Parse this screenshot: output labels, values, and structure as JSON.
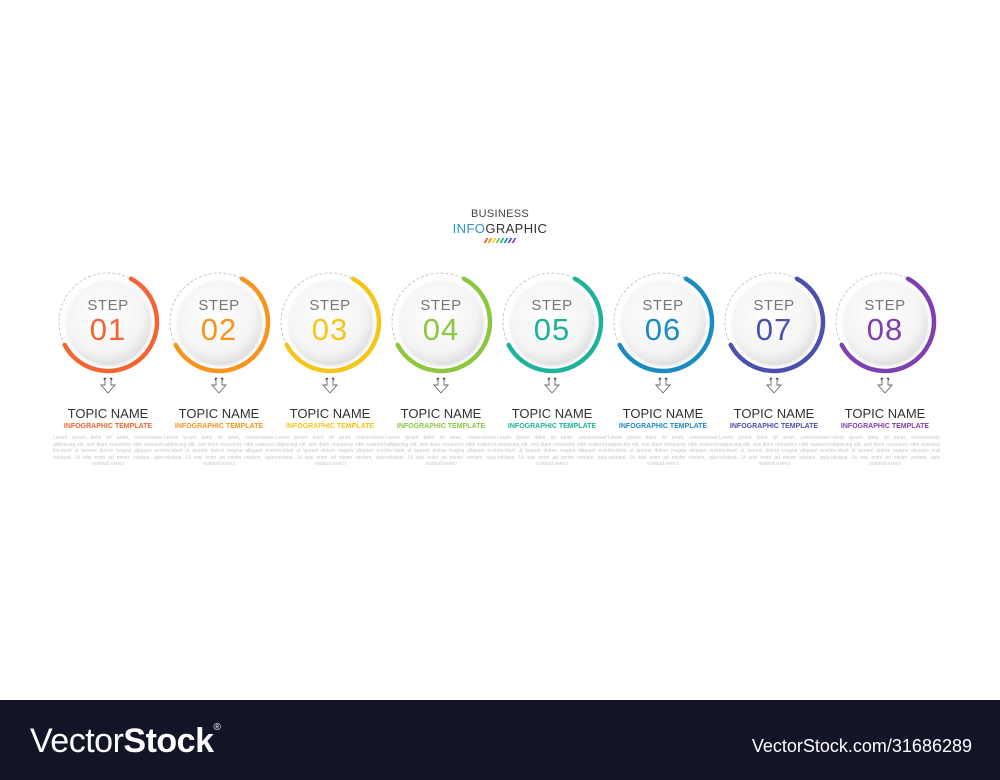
{
  "header": {
    "line1": "BUSINESS",
    "line2_highlight": "INFO",
    "line2_rest": "GRAPHIC",
    "rainbow_colors": [
      "#f15a24",
      "#f7931e",
      "#f9d423",
      "#8cc63f",
      "#1abc9c",
      "#1a8fc6",
      "#5b4fb0",
      "#8e44ad"
    ]
  },
  "steps": [
    {
      "label": "STEP",
      "number": "01",
      "color": "#f26532",
      "topic": "TOPIC NAME",
      "subtitle": "INFOGRAPHIC TEMPLATE",
      "body": "Lorem ipsum dolor sit amet, consectetuer adipiscing elit, sed diam nonummy nibh euismod tincidunt ut laoreet dolore magna aliquam erat volutpat. Ut wisi enim ad minim veniam, quis nostrud exerci"
    },
    {
      "label": "STEP",
      "number": "02",
      "color": "#f7941d",
      "topic": "TOPIC NAME",
      "subtitle": "INFOGRAPHIC TEMPLATE",
      "body": "Lorem ipsum dolor sit amet, consectetuer adipiscing elit, sed diam nonummy nibh euismod tincidunt ut laoreet dolore magna aliquam erat volutpat. Ut wisi enim ad minim veniam, quis nostrud exerci"
    },
    {
      "label": "STEP",
      "number": "03",
      "color": "#f5c518",
      "topic": "TOPIC NAME",
      "subtitle": "INFOGRAPHIC TEMPLATE",
      "body": "Lorem ipsum dolor sit amet, consectetuer adipiscing elit, sed diam nonummy nibh euismod tincidunt ut laoreet dolore magna aliquam erat volutpat. Ut wisi enim ad minim veniam, quis nostrud exerci"
    },
    {
      "label": "STEP",
      "number": "04",
      "color": "#8dc63f",
      "topic": "TOPIC NAME",
      "subtitle": "INFOGRAPHIC TEMPLATE",
      "body": "Lorem ipsum dolor sit amet, consectetuer adipiscing elit, sed diam nonummy nibh euismod tincidunt ut laoreet dolore magna aliquam erat volutpat. Ut wisi enim ad minim veniam, quis nostrud exerci"
    },
    {
      "label": "STEP",
      "number": "05",
      "color": "#1db39b",
      "topic": "TOPIC NAME",
      "subtitle": "INFOGRAPHIC TEMPLATE",
      "body": "Lorem ipsum dolor sit amet, consectetuer adipiscing elit, sed diam nonummy nibh euismod tincidunt ut laoreet dolore magna aliquam erat volutpat. Ut wisi enim ad minim veniam, quis nostrud exerci"
    },
    {
      "label": "STEP",
      "number": "06",
      "color": "#1a8cc2",
      "topic": "TOPIC NAME",
      "subtitle": "INFOGRAPHIC TEMPLATE",
      "body": "Lorem ipsum dolor sit amet, consectetuer adipiscing elit, sed diam nonummy nibh euismod tincidunt ut laoreet dolore magna aliquam erat volutpat. Ut wisi enim ad minim veniam, quis nostrud exerci"
    },
    {
      "label": "STEP",
      "number": "07",
      "color": "#4b4fae",
      "topic": "TOPIC NAME",
      "subtitle": "INFOGRAPHIC TEMPLATE",
      "body": "Lorem ipsum dolor sit amet, consectetuer adipiscing elit, sed diam nonummy nibh euismod tincidunt ut laoreet dolore magna aliquam erat volutpat. Ut wisi enim ad minim veniam, quis nostrud exerci"
    },
    {
      "label": "STEP",
      "number": "08",
      "color": "#7e3fb0",
      "topic": "TOPIC NAME",
      "subtitle": "INFOGRAPHIC TEMPLATE",
      "body": "Lorem ipsum dolor sit amet, consectetuer adipiscing elit, sed diam nonummy nibh euismod tincidunt ut laoreet dolore magna aliquam erat volutpat. Ut wisi enim ad minim veniam, quis nostrud exerci"
    }
  ],
  "footer": {
    "logo_light": "Vector",
    "logo_bold": "Stock",
    "logo_mark": "®",
    "url": "VectorStock.com/31686289"
  }
}
